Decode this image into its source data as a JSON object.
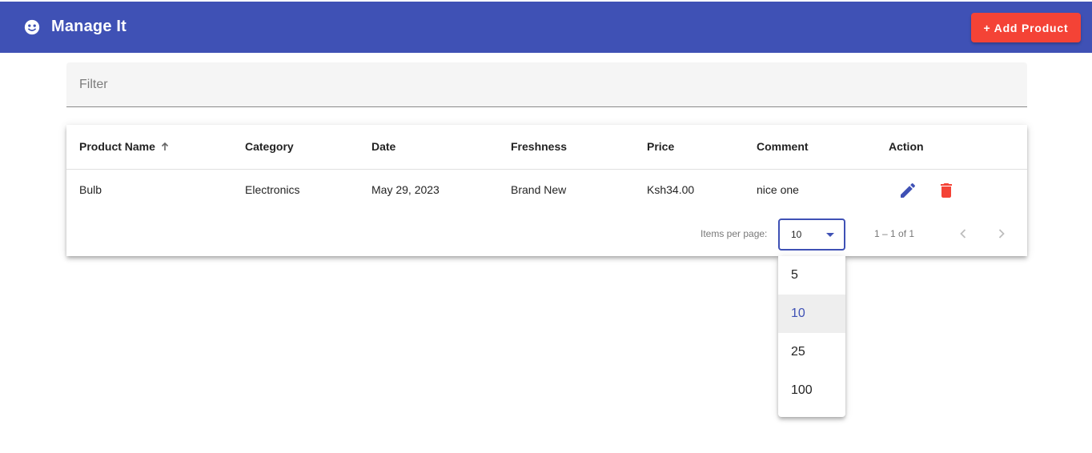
{
  "app": {
    "title": "Manage It",
    "add_button": "+ Add Product"
  },
  "filter": {
    "placeholder": "Filter",
    "value": ""
  },
  "table": {
    "columns": [
      "Product Name",
      "Category",
      "Date",
      "Freshness",
      "Price",
      "Comment",
      "Action"
    ],
    "sorted_column": "Product Name",
    "sort_direction": "ascending",
    "rows": [
      {
        "product_name": "Bulb",
        "category": "Electronics",
        "date": "May 29, 2023",
        "freshness": "Brand New",
        "price": "Ksh34.00",
        "comment": "nice one"
      }
    ]
  },
  "paginator": {
    "items_per_page_label": "Items per page:",
    "items_per_page": "10",
    "range_label": "1 – 1 of 1",
    "options": [
      "5",
      "10",
      "25",
      "100"
    ],
    "selected_option": "10"
  },
  "icons": {
    "brand": "face-icon",
    "sort": "arrow-up-icon",
    "edit": "pencil-icon",
    "delete": "trash-icon",
    "prev": "chevron-left-icon",
    "next": "chevron-right-icon"
  },
  "colors": {
    "primary": "#3f51b5",
    "warn": "#f44336",
    "edit_icon": "#3f51b5",
    "delete_icon": "#f44336"
  }
}
